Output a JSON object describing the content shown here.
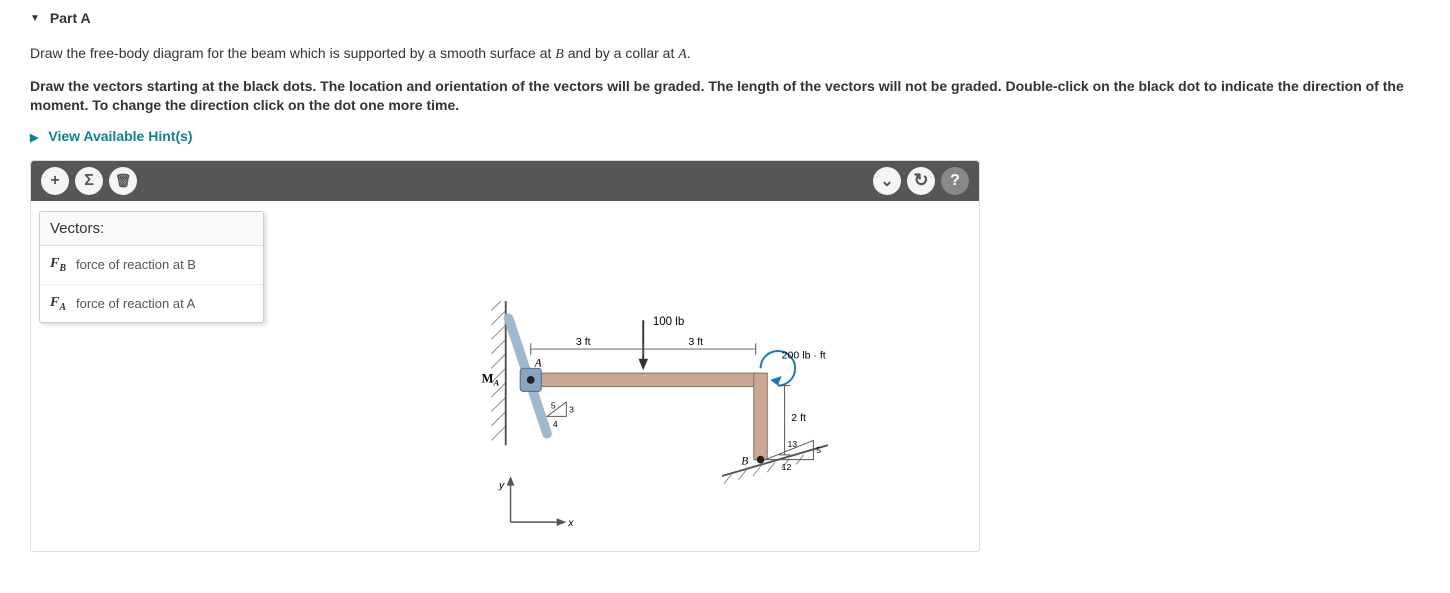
{
  "part": {
    "title": "Part A"
  },
  "intro": "Draw the free-body diagram for the beam which is supported by a smooth surface at B and by a collar at A.",
  "instructions": "Draw the vectors starting at the black dots. The location and orientation of the vectors will be graded. The length of the vectors will not be graded. Double-click on the black dot to indicate the direction of the moment. To change the direction click on the dot one more time.",
  "hints_label": "View Available Hint(s)",
  "toolbar": {
    "add": "+",
    "sigma": "Σ",
    "trash": "🗑",
    "expand": "⌄",
    "redo": "↻",
    "help": "?"
  },
  "panel": {
    "header": "Vectors:",
    "items": [
      {
        "symbol": "F",
        "subscript": "B",
        "desc": "force of reaction at B"
      },
      {
        "symbol": "F",
        "subscript": "A",
        "desc": "force of reaction at A"
      }
    ]
  },
  "diagram": {
    "load_label": "100 lb",
    "dim_left": "3 ft",
    "dim_right": "3 ft",
    "moment_label": "200 lb · ft",
    "vert_dim": "2 ft",
    "slope_run": "12",
    "slope_rise": "5",
    "slope_hyp": "13",
    "collar_run": "4",
    "collar_rise": "3",
    "collar_hyp": "5",
    "point_A": "A",
    "point_B": "B",
    "moment_A": "M",
    "moment_A_sub": "A",
    "axis_x": "x",
    "axis_y": "y"
  }
}
